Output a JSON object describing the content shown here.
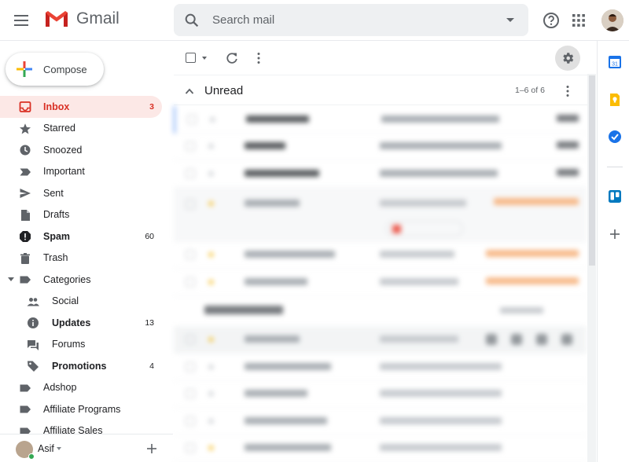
{
  "app": {
    "name": "Gmail"
  },
  "header": {
    "search_placeholder": "Search mail"
  },
  "sidebar": {
    "compose_label": "Compose",
    "items": [
      {
        "label": "Inbox",
        "count": "3",
        "icon": "inbox-icon"
      },
      {
        "label": "Starred",
        "count": "",
        "icon": "star-icon"
      },
      {
        "label": "Snoozed",
        "count": "",
        "icon": "clock-icon"
      },
      {
        "label": "Important",
        "count": "",
        "icon": "label-important-icon"
      },
      {
        "label": "Sent",
        "count": "",
        "icon": "send-icon"
      },
      {
        "label": "Drafts",
        "count": "",
        "icon": "draft-icon"
      },
      {
        "label": "Spam",
        "count": "60",
        "icon": "spam-icon"
      },
      {
        "label": "Trash",
        "count": "",
        "icon": "trash-icon"
      },
      {
        "label": "Categories",
        "count": "",
        "icon": "label-icon"
      },
      {
        "label": "Social",
        "count": "",
        "icon": "people-icon"
      },
      {
        "label": "Updates",
        "count": "13",
        "icon": "info-icon"
      },
      {
        "label": "Forums",
        "count": "",
        "icon": "forum-icon"
      },
      {
        "label": "Promotions",
        "count": "4",
        "icon": "tag-icon"
      },
      {
        "label": "Adshop",
        "count": "",
        "icon": "label-icon"
      },
      {
        "label": "Affiliate Programs",
        "count": "",
        "icon": "label-icon"
      },
      {
        "label": "Affiliate Sales",
        "count": "",
        "icon": "label-icon"
      }
    ],
    "hangouts_user": "Asif"
  },
  "main": {
    "unread_section": {
      "title": "Unread",
      "count_text": "1–6 of 6"
    },
    "colors": {
      "accent_red": "#d93025",
      "active_bg": "#fce8e6",
      "snoozed_orange": "#e8710a",
      "star_gold": "#f4b400"
    }
  }
}
